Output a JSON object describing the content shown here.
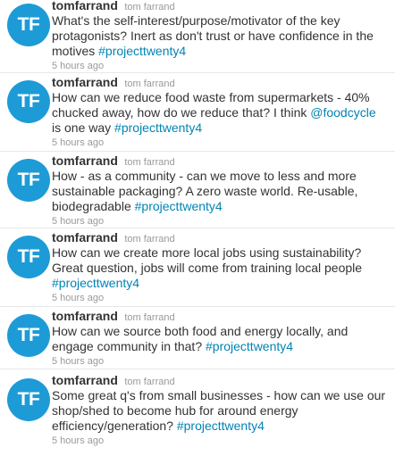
{
  "avatar_initials": "TF",
  "colors": {
    "avatar_bg": "#1d9bd6",
    "link": "#0084b4",
    "meta": "#999999",
    "text": "#333333"
  },
  "tweets": [
    {
      "screen_name": "tomfarrand",
      "full_name": "tom farrand",
      "parts": [
        {
          "text": "What's the self-interest/purpose/motivator of the key protagonists? Inert as don't trust or have confidence in the motives "
        },
        {
          "link": "#projecttwenty4"
        }
      ],
      "time": "5 hours ago"
    },
    {
      "screen_name": "tomfarrand",
      "full_name": "tom farrand",
      "parts": [
        {
          "text": "How can we reduce food waste from supermarkets - 40% chucked away, how do we reduce that? I think "
        },
        {
          "link": "@foodcycle"
        },
        {
          "text": " is one way "
        },
        {
          "link": "#projecttwenty4"
        }
      ],
      "time": "5 hours ago"
    },
    {
      "screen_name": "tomfarrand",
      "full_name": "tom farrand",
      "parts": [
        {
          "text": "How - as a community - can we move to less and more sustainable packaging? A zero waste world. Re-usable, biodegradable "
        },
        {
          "link": "#projecttwenty4"
        }
      ],
      "time": "5 hours ago"
    },
    {
      "screen_name": "tomfarrand",
      "full_name": "tom farrand",
      "parts": [
        {
          "text": "How can we create more local jobs using sustainability? Great question, jobs will come from training local people "
        },
        {
          "link": "#projecttwenty4"
        }
      ],
      "time": "5 hours ago"
    },
    {
      "screen_name": "tomfarrand",
      "full_name": "tom farrand",
      "parts": [
        {
          "text": "How can we source both food and energy locally, and engage community in that? "
        },
        {
          "link": "#projecttwenty4"
        }
      ],
      "time": "5 hours ago"
    },
    {
      "screen_name": "tomfarrand",
      "full_name": "tom farrand",
      "parts": [
        {
          "text": "Some great q's from small businesses - how can we use our shop/shed to become hub for around energy efficiency/generation? "
        },
        {
          "link": "#projecttwenty4"
        }
      ],
      "time": "5 hours ago"
    }
  ]
}
